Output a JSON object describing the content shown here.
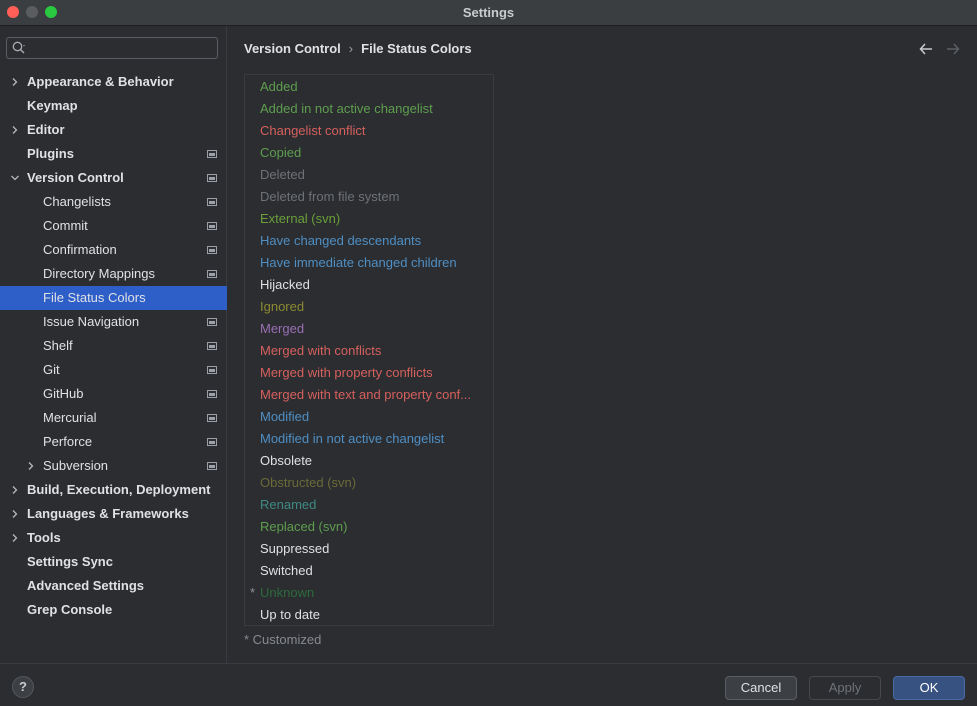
{
  "window": {
    "title": "Settings"
  },
  "search": {
    "placeholder": ""
  },
  "sidebar": {
    "items": [
      {
        "label": "Appearance & Behavior",
        "level": 0,
        "chevron": "right",
        "bold": true,
        "project": false
      },
      {
        "label": "Keymap",
        "level": 0,
        "chevron": "none",
        "bold": true,
        "project": false
      },
      {
        "label": "Editor",
        "level": 0,
        "chevron": "right",
        "bold": true,
        "project": false
      },
      {
        "label": "Plugins",
        "level": 0,
        "chevron": "none",
        "bold": true,
        "project": true
      },
      {
        "label": "Version Control",
        "level": 0,
        "chevron": "down",
        "bold": true,
        "project": true
      },
      {
        "label": "Changelists",
        "level": 1,
        "chevron": "none",
        "bold": false,
        "project": true
      },
      {
        "label": "Commit",
        "level": 1,
        "chevron": "none",
        "bold": false,
        "project": true
      },
      {
        "label": "Confirmation",
        "level": 1,
        "chevron": "none",
        "bold": false,
        "project": true
      },
      {
        "label": "Directory Mappings",
        "level": 1,
        "chevron": "none",
        "bold": false,
        "project": true
      },
      {
        "label": "File Status Colors",
        "level": 1,
        "chevron": "none",
        "bold": false,
        "project": false,
        "selected": true
      },
      {
        "label": "Issue Navigation",
        "level": 1,
        "chevron": "none",
        "bold": false,
        "project": true
      },
      {
        "label": "Shelf",
        "level": 1,
        "chevron": "none",
        "bold": false,
        "project": true
      },
      {
        "label": "Git",
        "level": 1,
        "chevron": "none",
        "bold": false,
        "project": true
      },
      {
        "label": "GitHub",
        "level": 1,
        "chevron": "none",
        "bold": false,
        "project": true
      },
      {
        "label": "Mercurial",
        "level": 1,
        "chevron": "none",
        "bold": false,
        "project": true
      },
      {
        "label": "Perforce",
        "level": 1,
        "chevron": "none",
        "bold": false,
        "project": true
      },
      {
        "label": "Subversion",
        "level": 1,
        "chevron": "right",
        "bold": false,
        "project": true
      },
      {
        "label": "Build, Execution, Deployment",
        "level": 0,
        "chevron": "right",
        "bold": true,
        "project": false
      },
      {
        "label": "Languages & Frameworks",
        "level": 0,
        "chevron": "right",
        "bold": true,
        "project": false
      },
      {
        "label": "Tools",
        "level": 0,
        "chevron": "right",
        "bold": true,
        "project": false
      },
      {
        "label": "Settings Sync",
        "level": 0,
        "chevron": "none",
        "bold": true,
        "project": false
      },
      {
        "label": "Advanced Settings",
        "level": 0,
        "chevron": "none",
        "bold": true,
        "project": false
      },
      {
        "label": "Grep Console",
        "level": 0,
        "chevron": "none",
        "bold": true,
        "project": false
      }
    ]
  },
  "breadcrumb": {
    "parent": "Version Control",
    "separator": "›",
    "current": "File Status Colors"
  },
  "file_statuses": [
    {
      "label": "Added",
      "color": "#5f9e4f",
      "customized": false
    },
    {
      "label": "Added in not active changelist",
      "color": "#5f9e4f",
      "customized": false
    },
    {
      "label": "Changelist conflict",
      "color": "#d6605e",
      "customized": false
    },
    {
      "label": "Copied",
      "color": "#5f9e4f",
      "customized": false
    },
    {
      "label": "Deleted",
      "color": "#6e7176",
      "customized": false
    },
    {
      "label": "Deleted from file system",
      "color": "#6e7176",
      "customized": false
    },
    {
      "label": "External (svn)",
      "color": "#6a9f3a",
      "customized": false
    },
    {
      "label": "Have changed descendants",
      "color": "#4f8fc4",
      "customized": false
    },
    {
      "label": "Have immediate changed children",
      "color": "#4f8fc4",
      "customized": false
    },
    {
      "label": "Hijacked",
      "color": "#dfe1e5",
      "customized": false
    },
    {
      "label": "Ignored",
      "color": "#8c8a32",
      "customized": false
    },
    {
      "label": "Merged",
      "color": "#9b6fb5",
      "customized": false
    },
    {
      "label": "Merged with conflicts",
      "color": "#d6605e",
      "customized": false
    },
    {
      "label": "Merged with property conflicts",
      "color": "#d6605e",
      "customized": false
    },
    {
      "label": "Merged with text and property conf...",
      "color": "#d6605e",
      "customized": false
    },
    {
      "label": "Modified",
      "color": "#4f8fc4",
      "customized": false
    },
    {
      "label": "Modified in not active changelist",
      "color": "#4f8fc4",
      "customized": false
    },
    {
      "label": "Obsolete",
      "color": "#dfe1e5",
      "customized": false
    },
    {
      "label": "Obstructed (svn)",
      "color": "#6c6a38",
      "customized": false
    },
    {
      "label": "Renamed",
      "color": "#3f8a84",
      "customized": false
    },
    {
      "label": "Replaced (svn)",
      "color": "#5f9e4f",
      "customized": false
    },
    {
      "label": "Suppressed",
      "color": "#dfe1e5",
      "customized": false
    },
    {
      "label": "Switched",
      "color": "#dfe1e5",
      "customized": false
    },
    {
      "label": "Unknown",
      "color": "#2d6a3d",
      "customized": true
    },
    {
      "label": "Up to date",
      "color": "#dfe1e5",
      "customized": false
    }
  ],
  "customized_marker": "*",
  "customized_note": "* Customized",
  "footer": {
    "help": "?",
    "cancel": "Cancel",
    "apply": "Apply",
    "ok": "OK"
  },
  "colors": {
    "selection": "#2e5fc8",
    "ok_button": "#375280"
  }
}
